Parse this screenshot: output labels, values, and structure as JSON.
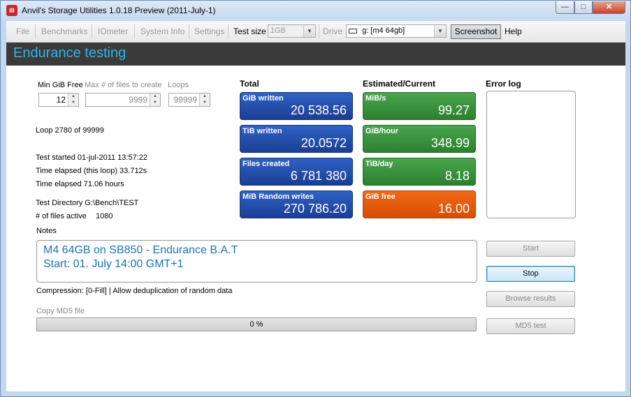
{
  "window": {
    "title": "Anvil's Storage Utilities 1.0.18 Preview (2011-July-1)",
    "app_icon": "anvil-app-icon",
    "app_icon_glyph": "III",
    "min_symbol": "—",
    "max_symbol": "□",
    "close_symbol": "✕"
  },
  "menu": {
    "file": "File",
    "benchmarks": "Benchmarks",
    "iometer": "IOmeter",
    "system_info": "System Info",
    "settings": "Settings",
    "test_size_label": "Test size",
    "test_size_value": "1GB",
    "drive_label": "Drive",
    "drive_value": "g: [m4 64gb]",
    "screenshot": "Screenshot",
    "help": "Help"
  },
  "header": {
    "title": "Endurance testing"
  },
  "params": {
    "min_gib_label": "Min GiB Free",
    "min_gib_value": "12",
    "max_files_label": "Max # of files to create",
    "max_files_value": "9999",
    "loops_label": "Loops",
    "loops_value": "99999"
  },
  "status": {
    "loop": "Loop 2780 of 99999",
    "test_started": "Test started 01-jul-2011 13:57:22",
    "elapsed_loop": "Time elapsed (this loop) 33.712s",
    "elapsed_total": "Time elapsed 71.06 hours",
    "test_dir": "Test Directory G:\\Bench\\TEST",
    "files_active_label": "# of files active",
    "files_active_value": "1080"
  },
  "totals": {
    "heading": "Total",
    "tiles": [
      {
        "label": "GiB written",
        "value": "20 538.56"
      },
      {
        "label": "TiB written",
        "value": "20.0572"
      },
      {
        "label": "Files created",
        "value": "6 781 380"
      },
      {
        "label": "MiB Random writes",
        "value": "270 786.20"
      }
    ]
  },
  "estimated": {
    "heading": "Estimated/Current",
    "tiles": [
      {
        "label": "MiB/s",
        "value": "99.27"
      },
      {
        "label": "GiB/hour",
        "value": "348.99"
      },
      {
        "label": "TiB/day",
        "value": "8.18"
      },
      {
        "label": "GiB free",
        "value": "16.00"
      }
    ]
  },
  "errorlog": {
    "heading": "Error log"
  },
  "notes": {
    "label": "Notes",
    "line1": "M4 64GB on SB850 - Endurance B.A.T",
    "line2": "Start: 01. July 14:00 GMT+1"
  },
  "compression": "Compression: [0-Fill] | Allow deduplication of random data",
  "md5": {
    "label": "Copy MD5 file",
    "progress_text": "0 %",
    "progress_fraction": 0
  },
  "buttons": {
    "start": "Start",
    "stop": "Stop",
    "browse": "Browse results",
    "md5test": "MD5 test"
  },
  "colors": {
    "header_bg": "#3a3a3a",
    "header_title": "#32b4e6",
    "tile_blue": "#1b3e93",
    "tile_green": "#2d7f30",
    "tile_orange": "#d64e04",
    "notes_text": "#1874b8"
  }
}
